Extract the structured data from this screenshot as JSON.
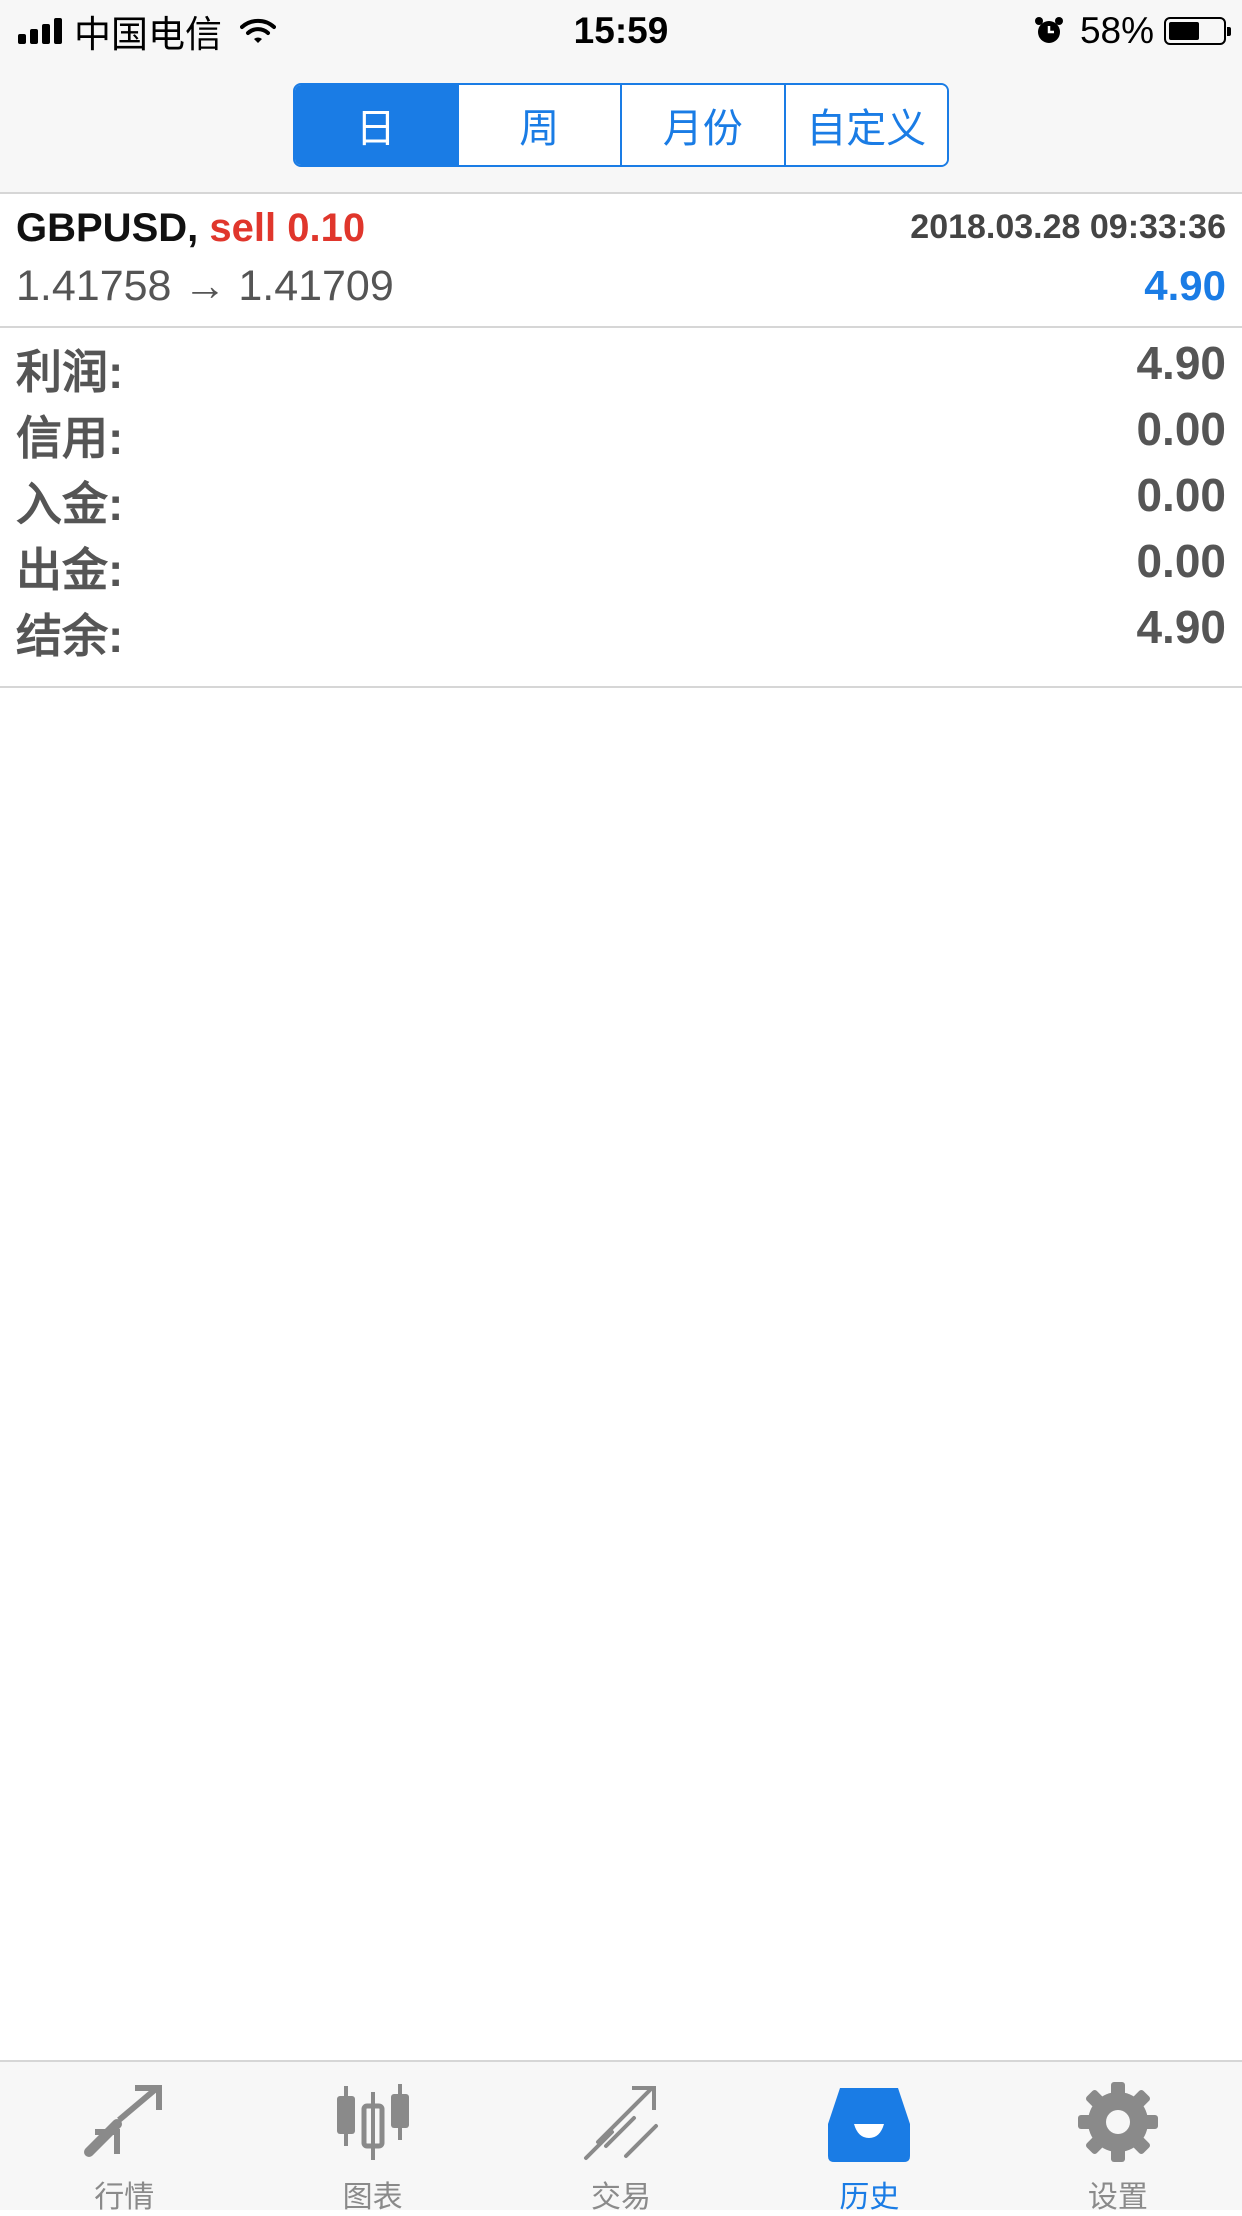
{
  "status_bar": {
    "carrier": "中国电信",
    "time": "15:59",
    "battery_percent": "58%",
    "battery_level": 0.58
  },
  "period_tabs": [
    "日",
    "周",
    "月份",
    "自定义"
  ],
  "period_selected": "日",
  "trade": {
    "symbol": "GBPUSD,",
    "side_volume": "sell 0.10",
    "datetime": "2018.03.28 09:33:36",
    "prices": "1.41758 → 1.41709",
    "profit": "4.90"
  },
  "summary": [
    {
      "label": "利润:",
      "value": "4.90"
    },
    {
      "label": "信用:",
      "value": "0.00"
    },
    {
      "label": "入金:",
      "value": "0.00"
    },
    {
      "label": "出金:",
      "value": "0.00"
    },
    {
      "label": "结余:",
      "value": "4.90"
    }
  ],
  "tabbar": {
    "items": [
      {
        "label": "行情",
        "icon": "quotes-icon"
      },
      {
        "label": "图表",
        "icon": "chart-icon"
      },
      {
        "label": "交易",
        "icon": "trade-icon"
      },
      {
        "label": "历史",
        "icon": "history-icon"
      },
      {
        "label": "设置",
        "icon": "settings-icon"
      }
    ],
    "selected": "历史"
  },
  "colors": {
    "accent": "#1a7ce5",
    "sell": "#e0362c",
    "icon_gray": "#8a8a8a"
  }
}
